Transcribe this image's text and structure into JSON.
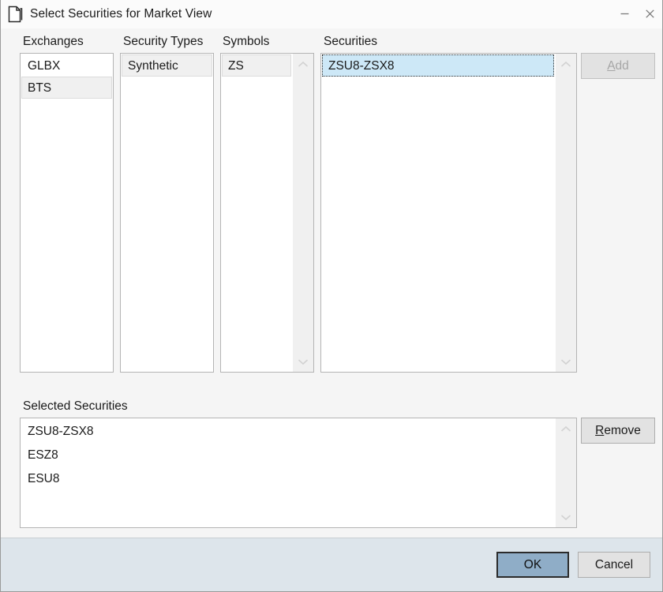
{
  "window": {
    "title": "Select Securities for Market View",
    "icon": "document-icon",
    "controls": {
      "minimize": "minimize-icon",
      "close": "close-icon"
    }
  },
  "colors": {
    "body_background": "#f5f5f5",
    "titlebar_background": "#fbfbfb",
    "footer_background": "#dde5eb",
    "listbox_background": "#ffffff",
    "listbox_border": "#b4b4b4",
    "selection_blue": "#cde8f7",
    "selection_gray": "#f0f0f0",
    "default_button": "#8fadc7",
    "button_face": "#e2e2e2",
    "disabled_text": "#a6a6a6",
    "text": "#1b1b1b"
  },
  "columns": [
    {
      "key": "exchanges",
      "label": "Exchanges",
      "items": [
        {
          "text": "GLBX",
          "state": "normal"
        },
        {
          "text": "BTS",
          "state": "selected-unfocused"
        }
      ],
      "scrollbar": false
    },
    {
      "key": "security_types",
      "label": "Security Types",
      "items": [
        {
          "text": "Synthetic",
          "state": "selected-unfocused"
        }
      ],
      "scrollbar": false
    },
    {
      "key": "symbols",
      "label": "Symbols",
      "items": [
        {
          "text": "ZS",
          "state": "selected-unfocused"
        }
      ],
      "scrollbar": true
    },
    {
      "key": "securities",
      "label": "Securities",
      "items": [
        {
          "text": "ZSU8-ZSX8",
          "state": "selected-focused"
        }
      ],
      "scrollbar": true
    }
  ],
  "add_button": {
    "label": "Add",
    "accelerator": "A",
    "enabled": false
  },
  "selected_securities": {
    "label": "Selected Securities",
    "items": [
      {
        "text": "ZSU8-ZSX8"
      },
      {
        "text": "ESZ8"
      },
      {
        "text": "ESU8"
      }
    ],
    "scrollbar": true
  },
  "remove_button": {
    "label": "Remove",
    "accelerator": "R",
    "enabled": true
  },
  "footer": {
    "ok_label": "OK",
    "cancel_label": "Cancel",
    "default_button": "OK"
  },
  "icons": {
    "scroll_up": "chevron-up-icon",
    "scroll_down": "chevron-down-icon"
  }
}
